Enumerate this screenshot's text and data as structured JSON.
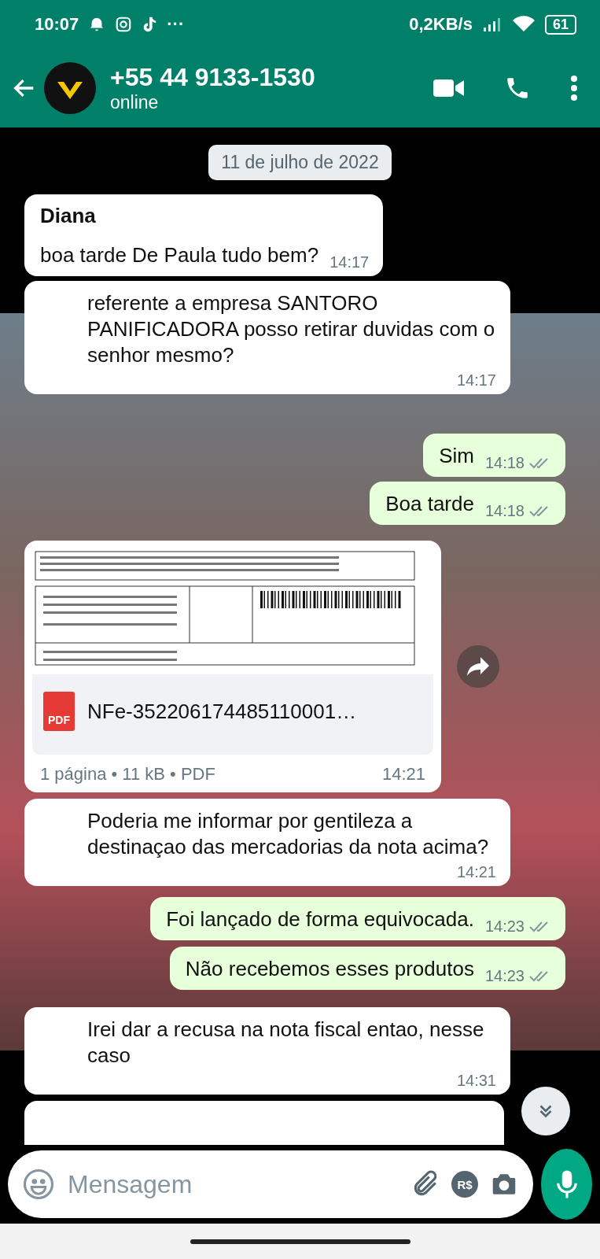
{
  "status_bar": {
    "time": "10:07",
    "more": "···",
    "speed": "0,2KB/s",
    "battery": "61"
  },
  "header": {
    "title": "+55 44 9133-1530",
    "subtitle": "online"
  },
  "date_chip": "11 de julho de 2022",
  "messages": [
    {
      "kind": "text",
      "out": false,
      "sender": "Diana",
      "text": "boa tarde De Paula tudo bem?",
      "time": "14:17"
    },
    {
      "kind": "text",
      "out": false,
      "text": "referente a empresa SANTORO PANIFICADORA posso retirar duvidas com o senhor mesmo?",
      "time": "14:17"
    },
    {
      "kind": "text",
      "out": true,
      "text": "Sim",
      "time": "14:18",
      "read": false
    },
    {
      "kind": "text",
      "out": true,
      "text": "Boa tarde",
      "time": "14:18",
      "read": false
    },
    {
      "kind": "document",
      "out": false,
      "file_name": "NFe-352206174485110001…",
      "file_type": "PDF",
      "meta": "1 página • 11 kB • PDF",
      "time": "14:21"
    },
    {
      "kind": "text",
      "out": false,
      "text": "Poderia me informar por gentileza a destinaçao das mercadorias da nota acima?",
      "time": "14:21"
    },
    {
      "kind": "text",
      "out": true,
      "text": "Foi lançado de forma equivocada.",
      "time": "14:23",
      "read": false
    },
    {
      "kind": "text",
      "out": true,
      "text": "Não recebemos esses produtos",
      "time": "14:23",
      "read": false
    },
    {
      "kind": "text",
      "out": false,
      "text": "Irei dar a recusa na nota fiscal entao, nesse caso",
      "time": "14:31"
    },
    {
      "kind": "partial",
      "out": false
    }
  ],
  "composer": {
    "placeholder": "Mensagem",
    "pay_label": "R$"
  }
}
